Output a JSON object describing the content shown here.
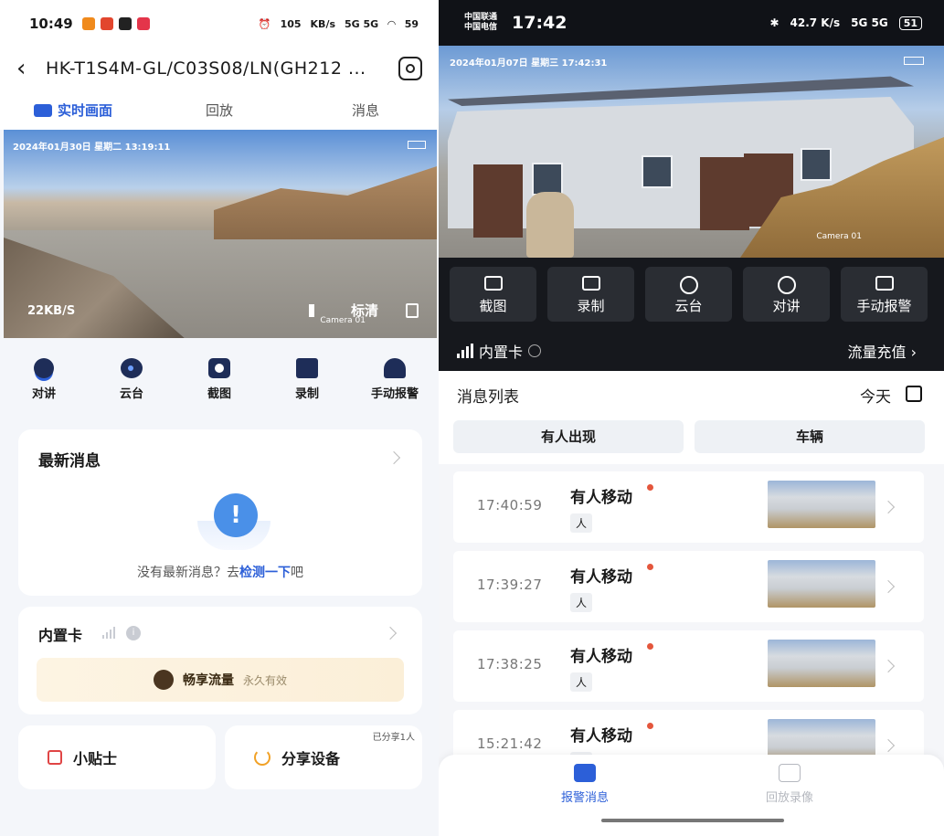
{
  "left": {
    "status": {
      "time": "10:49",
      "speed": "105",
      "speed_unit": "KB/s",
      "net": "5G 5G",
      "batt": "59"
    },
    "nav": {
      "title": "HK-T1S4M-GL/C03S08/LN(GH212 ..."
    },
    "tabs": [
      "实时画面",
      "回放",
      "消息"
    ],
    "video": {
      "timestamp": "2024年01月30日 星期二 13:19:11",
      "rate": "22KB/S",
      "camera": "Camera 01",
      "quality": "标清"
    },
    "actions": [
      {
        "label": "对讲",
        "icon": "mic-icon"
      },
      {
        "label": "云台",
        "icon": "ptz-icon"
      },
      {
        "label": "截图",
        "icon": "camera-icon"
      },
      {
        "label": "录制",
        "icon": "video-record-icon"
      },
      {
        "label": "手动报警",
        "icon": "alarm-icon"
      }
    ],
    "news": {
      "title": "最新消息",
      "empty_prefix": "没有最新消息？去",
      "empty_link": "检测一下",
      "empty_suffix": "吧",
      "bubble": "!"
    },
    "sim": {
      "title": "内置卡",
      "info": "i",
      "banner_title": "畅享流量",
      "banner_sub": "永久有效"
    },
    "tip": {
      "label": "小贴士"
    },
    "share": {
      "label": "分享设备",
      "count": "已分享1人"
    }
  },
  "right": {
    "status": {
      "carrier1": "中国联通",
      "carrier2": "中国电信",
      "time": "17:42",
      "speed": "42.7 K/s",
      "net": "5G 5G",
      "batt": "51"
    },
    "video": {
      "timestamp": "2024年01月07日 星期三 17:42:31",
      "camera": "Camera 01"
    },
    "controls": [
      {
        "label": "截图",
        "icon": "camera-icon"
      },
      {
        "label": "录制",
        "icon": "video-record-icon"
      },
      {
        "label": "云台",
        "icon": "ptz-icon"
      },
      {
        "label": "对讲",
        "icon": "mic-icon"
      },
      {
        "label": "手动报警",
        "icon": "alarm-icon"
      }
    ],
    "sim": {
      "label": "内置卡",
      "topup": "流量充值 ›"
    },
    "list": {
      "title": "消息列表",
      "date": "今天"
    },
    "filters": [
      "有人出现",
      "车辆"
    ],
    "items": [
      {
        "time": "17:40:59",
        "event": "有人移动",
        "tag": "人"
      },
      {
        "time": "17:39:27",
        "event": "有人移动",
        "tag": "人"
      },
      {
        "time": "17:38:25",
        "event": "有人移动",
        "tag": "人"
      },
      {
        "time": "15:21:42",
        "event": "有人移动",
        "tag": "人"
      }
    ],
    "tabbar": [
      "报警消息",
      "回放录像"
    ]
  }
}
